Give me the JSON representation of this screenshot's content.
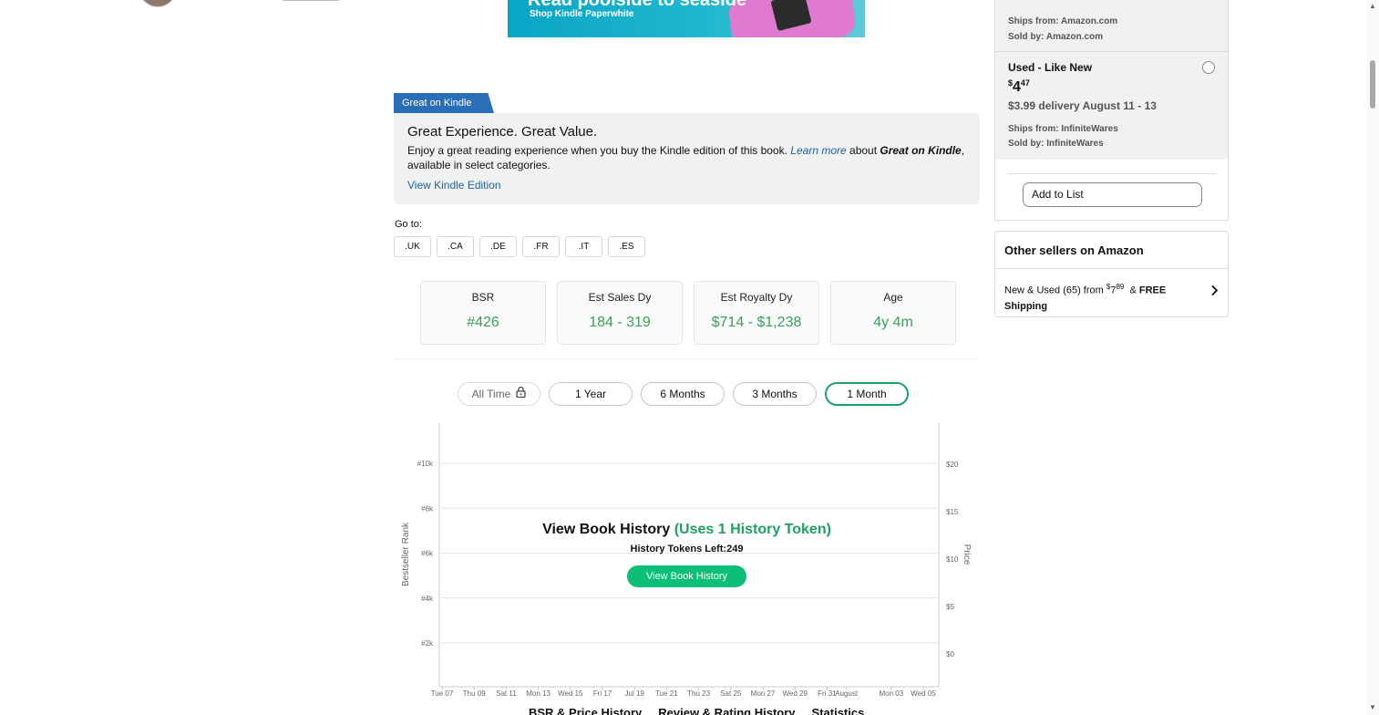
{
  "banner": {
    "title": "Read poolside to seaside",
    "subtitle": "Shop Kindle Paperwhite"
  },
  "great_on_kindle": {
    "tag": "Great on Kindle",
    "title": "Great Experience. Great Value.",
    "text_before": "Enjoy a great reading experience when you buy the Kindle edition of this book.",
    "learn_more": "Learn more",
    "text_mid": "about",
    "brand": "Great on Kindle",
    "text_after": ", available in select categories.",
    "view_link": "View Kindle Edition"
  },
  "goto": {
    "label": "Go to:",
    "options": [
      ".UK",
      ".CA",
      ".DE",
      ".FR",
      ".IT",
      ".ES"
    ]
  },
  "stats": [
    {
      "label": "BSR",
      "value": "#426"
    },
    {
      "label": "Est Sales Dy",
      "value": "184 - 319"
    },
    {
      "label": "Est Royalty Dy",
      "value": "$714 - $1,238"
    },
    {
      "label": "Age",
      "value": "4y 4m"
    }
  ],
  "ranges": [
    {
      "label": "All Time",
      "locked": true
    },
    {
      "label": "1 Year"
    },
    {
      "label": "6 Months"
    },
    {
      "label": "3 Months"
    },
    {
      "label": "1 Month",
      "active": true
    }
  ],
  "history_overlay": {
    "title": "View Book History",
    "title_note": "(Uses 1 History Token)",
    "tokens_left": "History Tokens Left:249",
    "button": "View Book History"
  },
  "chart_data": {
    "type": "line",
    "title": "",
    "xlabel": "",
    "ylabel": "Bestseller Rank",
    "y2label": "Price",
    "x_ticks": [
      "Tue 07",
      "Thu 09",
      "Sat 11",
      "Mon 13",
      "Wed 15",
      "Fri 17",
      "Jul 19",
      "Tue 21",
      "Thu 23",
      "Sat 25",
      "Mon 27",
      "Wed 29",
      "Fri 31",
      "August",
      "Mon 03",
      "Wed 05"
    ],
    "y_ticks": [
      "#2k",
      "#4k",
      "#6k",
      "#8k",
      "#10k"
    ],
    "y_tick_values": [
      2000,
      4000,
      6000,
      8000,
      10000
    ],
    "y2_ticks": [
      "$0",
      "$5",
      "$10",
      "$15",
      "$20"
    ],
    "y2_tick_values": [
      0,
      5,
      10,
      15,
      20
    ],
    "grid": true,
    "series": []
  },
  "chart_tabs": [
    "BSR & Price History",
    "Review & Rating History",
    "Statistics"
  ],
  "buy_box": {
    "ships_from_1": "Ships from: Amazon.com",
    "sold_by_1": "Sold by: Amazon.com",
    "condition": "Used - Like New",
    "price_currency": "$",
    "price_whole": "4",
    "price_fraction": "47",
    "delivery": "$3.99 delivery August 11 - 13",
    "ships_from_2": "Ships from: InfiniteWares",
    "sold_by_2": "Sold by: InfiniteWares",
    "add_to_list": "Add to List"
  },
  "other_sellers": {
    "title": "Other sellers on Amazon",
    "text_prefix": "New & Used (65) from",
    "price_currency": "$",
    "price_whole": "7",
    "price_fraction": "89",
    "free_prefix": "&",
    "free": "FREE Shipping"
  },
  "colors": {
    "kindle_blue": "#2a6eb8",
    "stat_green": "#3aa05a",
    "cta_green": "#0bbf78",
    "link_blue": "#2162a1"
  }
}
